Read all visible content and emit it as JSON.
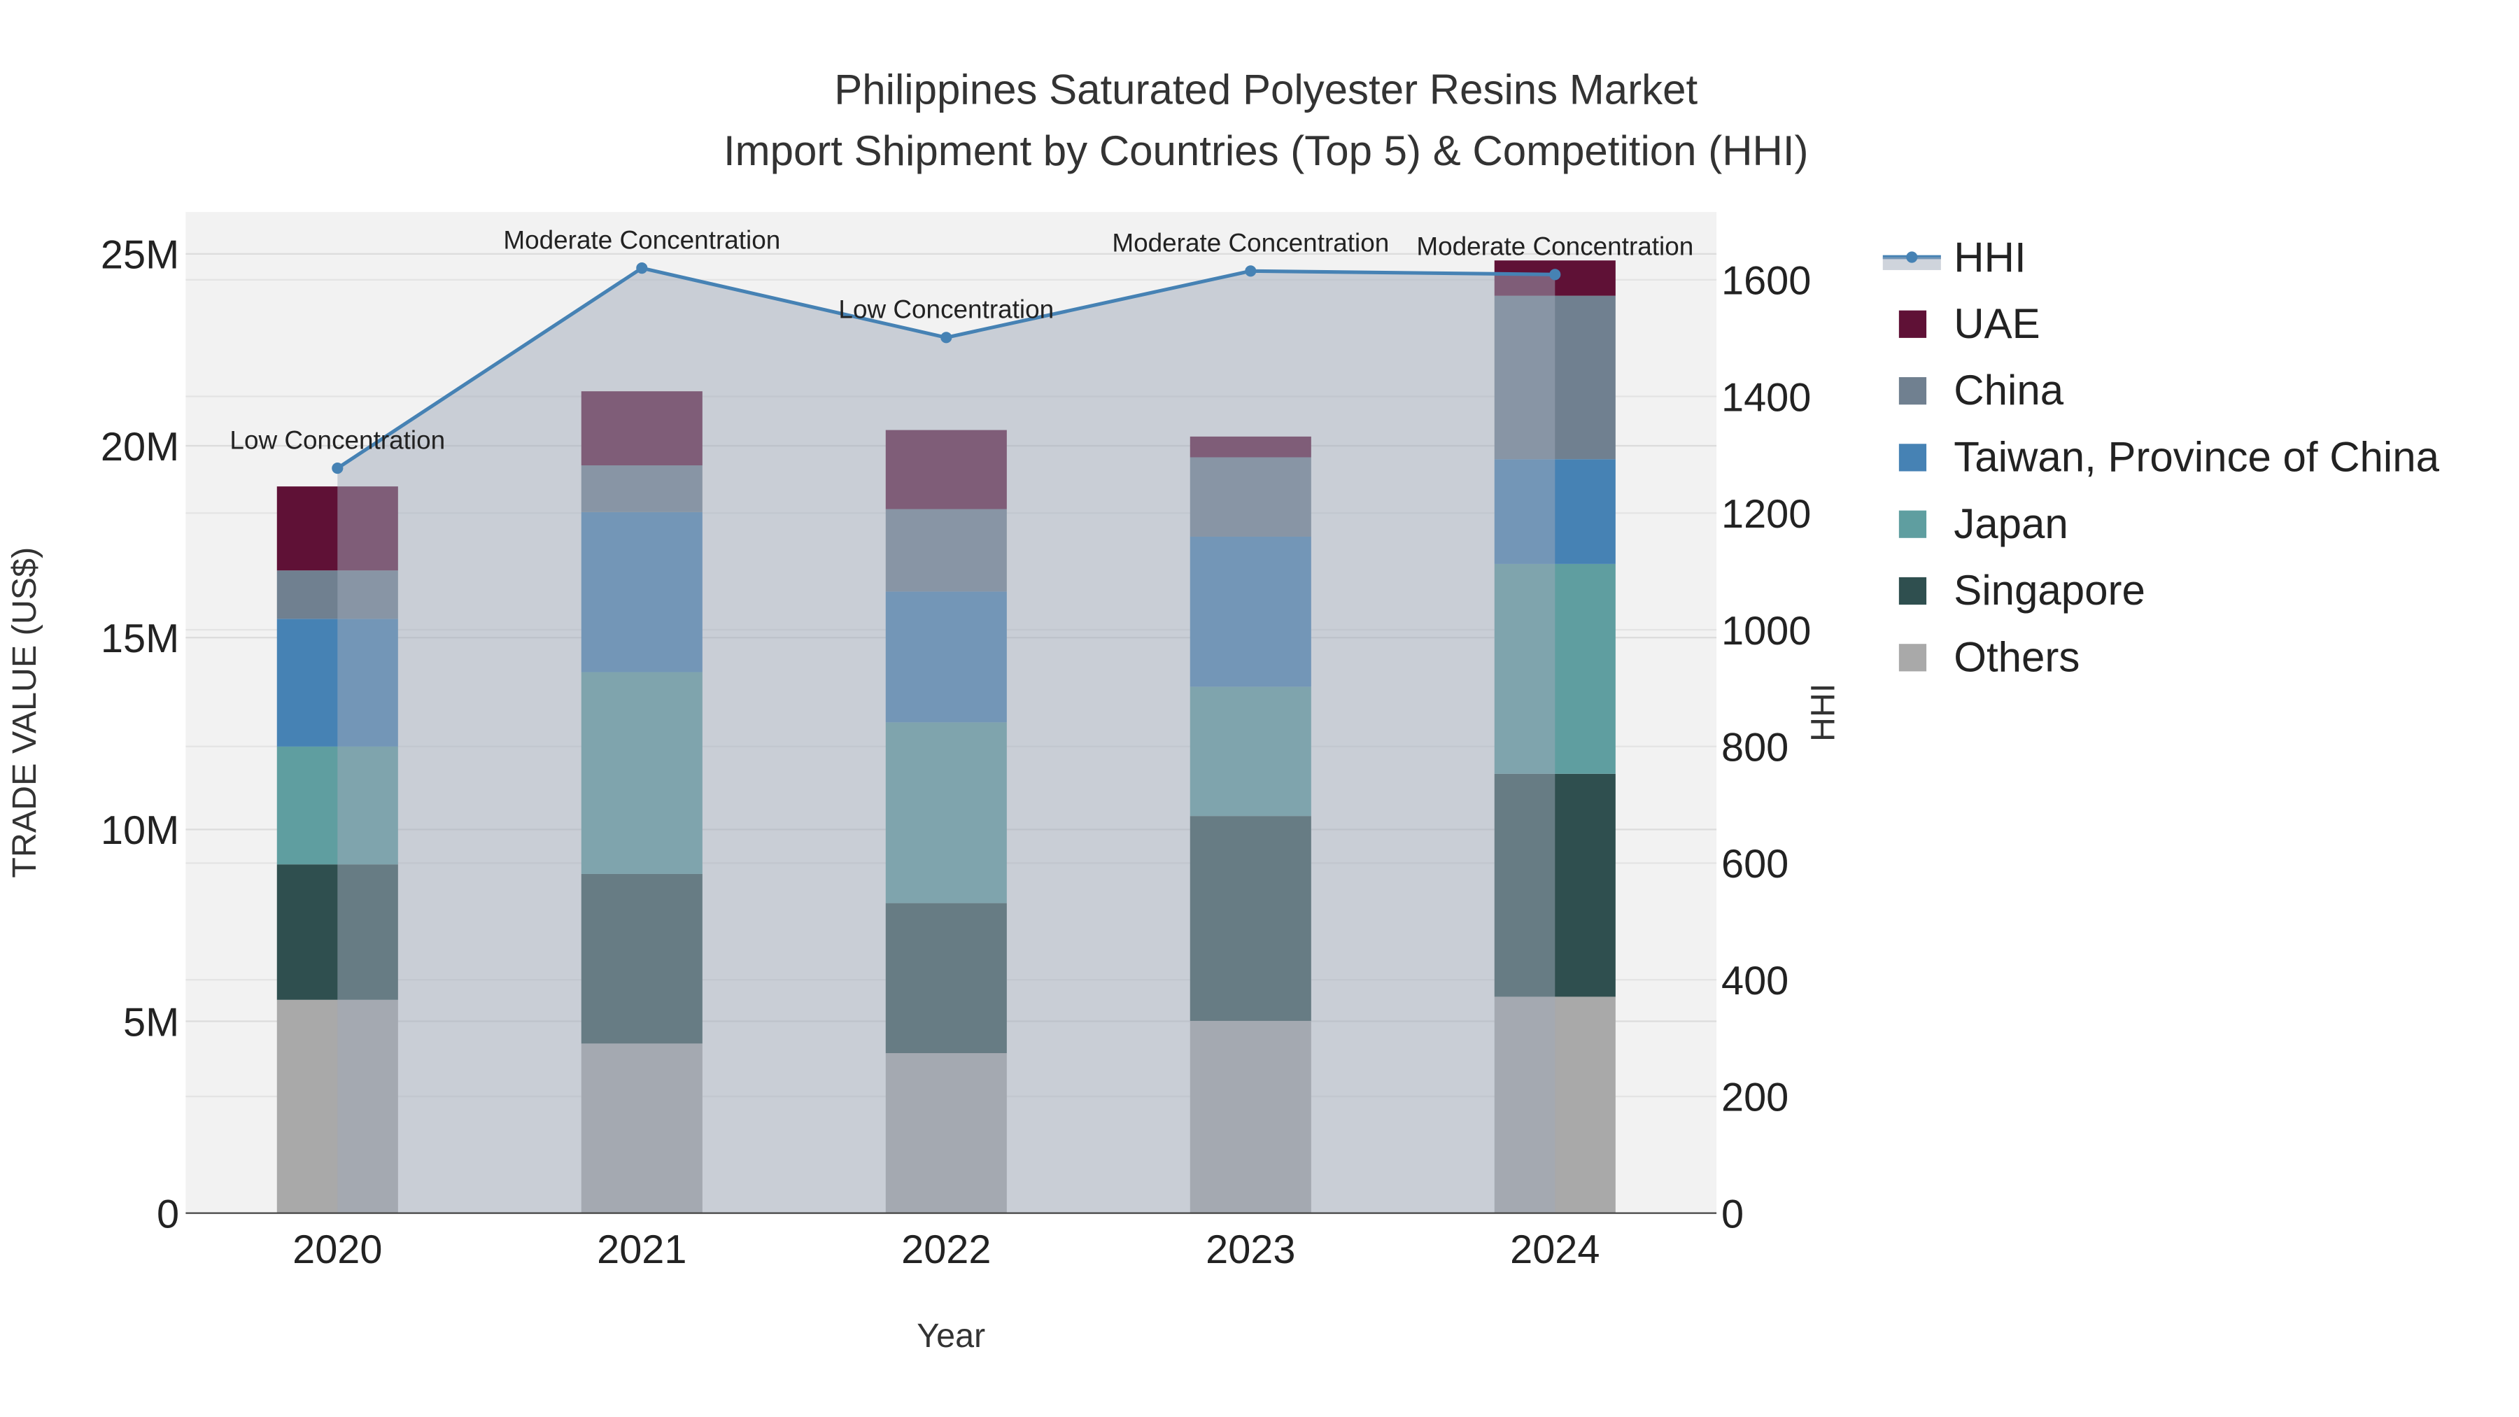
{
  "chart_data": {
    "type": "bar",
    "stacked": true,
    "title_line1": "Philippines Saturated Polyester Resins Market",
    "title_line2": "Import Shipment by Countries (Top 5) & Competition (HHI)",
    "xlabel": "Year",
    "ylabel": "TRADE VALUE (US$)",
    "y2label": "HHI",
    "categories": [
      "2020",
      "2021",
      "2022",
      "2023",
      "2024"
    ],
    "ylim": [
      0,
      26000000
    ],
    "y2lim": [
      0,
      1720
    ],
    "yticks": [
      {
        "v": 0,
        "label": "0"
      },
      {
        "v": 5000000,
        "label": "5M"
      },
      {
        "v": 10000000,
        "label": "10M"
      },
      {
        "v": 15000000,
        "label": "15M"
      },
      {
        "v": 20000000,
        "label": "20M"
      },
      {
        "v": 25000000,
        "label": "25M"
      }
    ],
    "y2ticks": [
      {
        "v": 0,
        "label": "0"
      },
      {
        "v": 200,
        "label": "200"
      },
      {
        "v": 400,
        "label": "400"
      },
      {
        "v": 600,
        "label": "600"
      },
      {
        "v": 800,
        "label": "800"
      },
      {
        "v": 1000,
        "label": "1000"
      },
      {
        "v": 1200,
        "label": "1200"
      },
      {
        "v": 1400,
        "label": "1400"
      },
      {
        "v": 1600,
        "label": "1600"
      }
    ],
    "series": [
      {
        "name": "Others",
        "color": "#a9a9a9",
        "values": [
          5560000,
          4420000,
          4170000,
          5010000,
          5640000
        ]
      },
      {
        "name": "Singapore",
        "color": "#2f4f4f",
        "values": [
          3530000,
          4420000,
          3910000,
          5340000,
          5810000
        ]
      },
      {
        "name": "Japan",
        "color": "#5f9ea0",
        "values": [
          3070000,
          5260000,
          4710000,
          3370000,
          5470000
        ]
      },
      {
        "name": "Taiwan, Province of China",
        "color": "#4682b4",
        "values": [
          3330000,
          4170000,
          3410000,
          3910000,
          2730000
        ]
      },
      {
        "name": "China",
        "color": "#708090",
        "values": [
          1260000,
          1220000,
          2150000,
          2070000,
          4260000
        ]
      },
      {
        "name": "UAE",
        "color": "#5f1136",
        "values": [
          2190000,
          1930000,
          2060000,
          540000,
          920000
        ]
      }
    ],
    "hhi": {
      "name": "HHI",
      "color": "#4682b4",
      "values": [
        1277,
        1620,
        1501,
        1615,
        1609
      ],
      "annotations": [
        "Low Concentration",
        "Moderate Concentration",
        "Low Concentration",
        "Moderate Concentration",
        "Moderate Concentration"
      ]
    },
    "legend_position": "right",
    "legend_order": [
      "HHI",
      "UAE",
      "China",
      "Taiwan, Province of China",
      "Japan",
      "Singapore",
      "Others"
    ]
  }
}
